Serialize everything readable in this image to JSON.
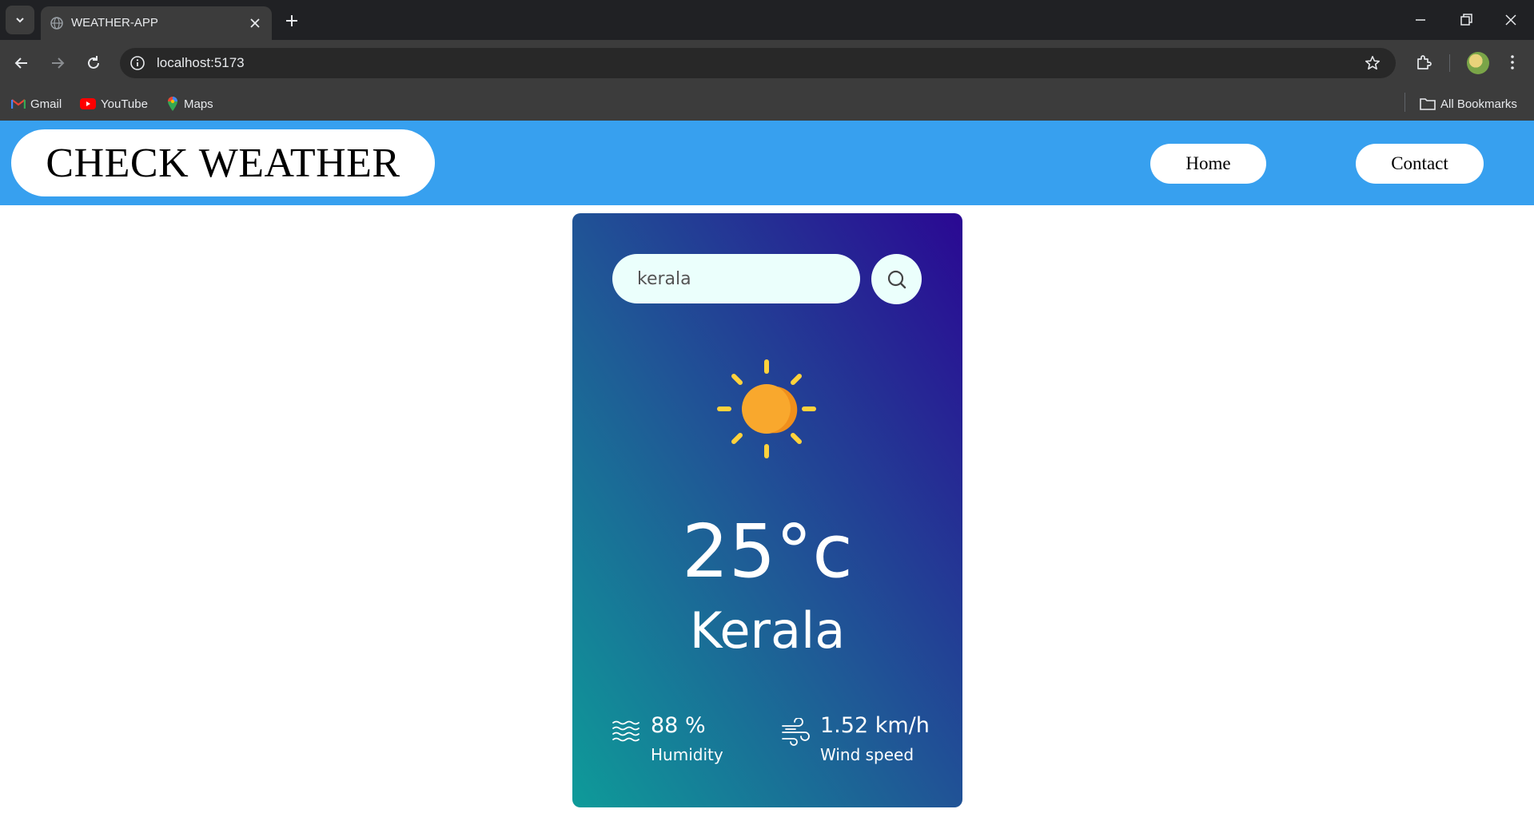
{
  "browser": {
    "tab_title": "WEATHER-APP",
    "url": "localhost:5173",
    "bookmarks": [
      {
        "label": "Gmail",
        "icon": "gmail-icon"
      },
      {
        "label": "YouTube",
        "icon": "youtube-icon"
      },
      {
        "label": "Maps",
        "icon": "maps-icon"
      }
    ],
    "all_bookmarks_label": "All Bookmarks"
  },
  "navbar": {
    "brand": "CHECK WEATHER",
    "links": [
      {
        "label": "Home"
      },
      {
        "label": "Contact"
      }
    ]
  },
  "weather": {
    "search": {
      "value": "kerala"
    },
    "icon": "sun-icon",
    "temperature": "25°c",
    "city": "Kerala",
    "humidity": {
      "value": "88 %",
      "label": "Humidity",
      "icon": "humidity-icon"
    },
    "wind": {
      "value": "1.52 km/h",
      "label": "Wind speed",
      "icon": "wind-icon"
    }
  },
  "colors": {
    "navbar_bg": "#37a0ef",
    "card_gradient_start": "#0e9b99",
    "card_gradient_end": "#2a0893",
    "sun": "#f9a82d",
    "sun_rays": "#ffd23c"
  }
}
